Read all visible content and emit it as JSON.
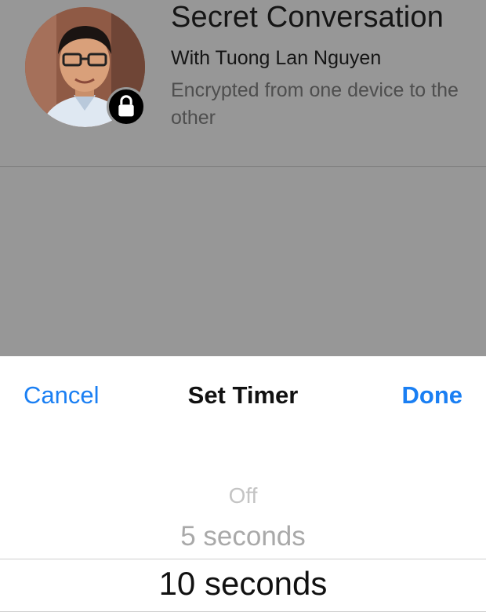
{
  "conversation": {
    "title": "Secret Conversation",
    "with_label": "With Tuong Lan Nguyen",
    "description": "Encrypted from one device to the other",
    "avatar": "user-photo",
    "badge_icon": "lock-icon"
  },
  "timer_sheet": {
    "title": "Set Timer",
    "cancel_label": "Cancel",
    "done_label": "Done",
    "options": [
      "Off",
      "5 seconds",
      "10 seconds"
    ],
    "selected": "10 seconds"
  },
  "colors": {
    "accent": "#1a7ff3",
    "overlay": "#979797",
    "sheet_background": "#ffffff"
  }
}
